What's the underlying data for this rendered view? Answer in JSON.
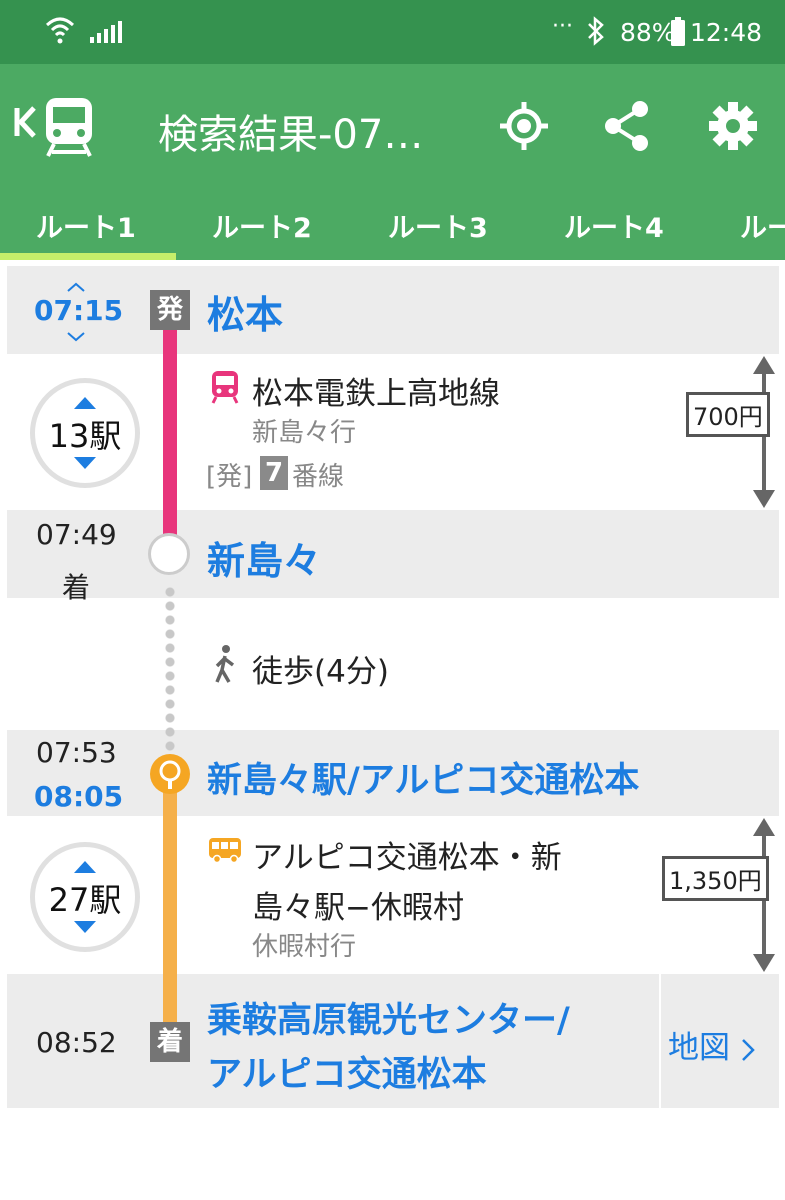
{
  "status_bar": {
    "dots": "···",
    "battery_pct": "88%",
    "clock": "12:48"
  },
  "app_bar": {
    "title": "検索結果-07…"
  },
  "tabs": [
    {
      "label": "ルート1",
      "selected": true
    },
    {
      "label": "ルート2",
      "selected": false
    },
    {
      "label": "ルート3",
      "selected": false
    },
    {
      "label": "ルート4",
      "selected": false
    },
    {
      "label": "ルー",
      "selected": false
    }
  ],
  "route": {
    "departure": {
      "time": "07:15",
      "badge": "発",
      "station": "松本"
    },
    "leg1": {
      "line": "松本電鉄上高地線",
      "direction": "新島々行",
      "platform_prefix": "[発]",
      "platform_num": "7",
      "platform_suffix": "番線",
      "stops": "13駅",
      "fare": "700円",
      "color": "#e8357c"
    },
    "transfer1": {
      "arrive_time": "07:49",
      "arrive_label": "着",
      "station": "新島々"
    },
    "walk": {
      "label": "徒歩(4分)"
    },
    "transfer2": {
      "arrive_time": "07:53",
      "depart_time": "08:05",
      "station": "新島々駅/アルピコ交通松本"
    },
    "leg2": {
      "line_1": "アルピコ交通松本・新",
      "line_2": "島々駅−休暇村",
      "direction": "休暇村行",
      "stops": "27駅",
      "fare": "1,350円",
      "color": "#f5b04a"
    },
    "arrival": {
      "time": "08:52",
      "badge": "着",
      "station_1": "乗鞍高原観光センター/",
      "station_2": "アルピコ交通松本",
      "map_label": "地図"
    }
  },
  "colors": {
    "status_bar": "#35924f",
    "app_bar": "#4caa63",
    "tab_indicator": "#c5ef6a",
    "link_blue": "#1d7de0"
  }
}
